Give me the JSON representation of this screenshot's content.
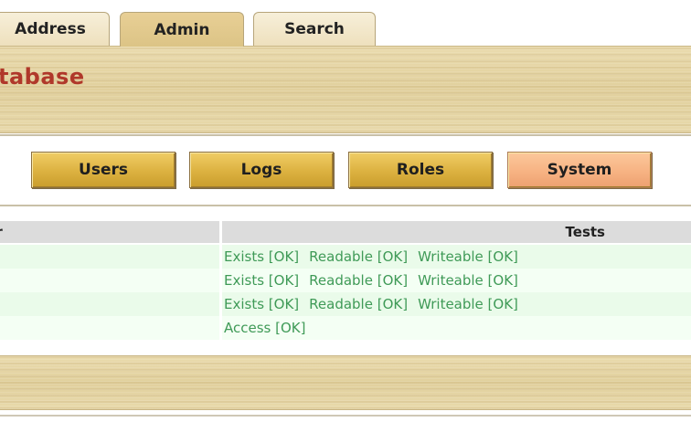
{
  "tabs": [
    {
      "label": "Address",
      "active": false
    },
    {
      "label": "Admin",
      "active": true
    },
    {
      "label": "Search",
      "active": false
    }
  ],
  "page": {
    "title": "tabase"
  },
  "nav_buttons": [
    {
      "label": "Users",
      "selected": false
    },
    {
      "label": "Logs",
      "selected": false
    },
    {
      "label": "Roles",
      "selected": false
    },
    {
      "label": "System",
      "selected": true
    }
  ],
  "table": {
    "headers": {
      "parameter": "ter",
      "tests": "Tests"
    },
    "rows": [
      {
        "tests": [
          "Exists [OK]",
          "Readable [OK]",
          "Writeable [OK]"
        ]
      },
      {
        "tests": [
          "Exists [OK]",
          "Readable [OK]",
          "Writeable [OK]"
        ]
      },
      {
        "tests": [
          "Exists [OK]",
          "Readable [OK]",
          "Writeable [OK]"
        ]
      },
      {
        "tests": [
          "Access [OK]"
        ]
      }
    ]
  },
  "colors": {
    "title": "#b0382a",
    "ok_text": "#3f9a57",
    "button_gold": "#dcb140",
    "button_selected": "#f7b383",
    "wood": "#e6d6a6"
  }
}
